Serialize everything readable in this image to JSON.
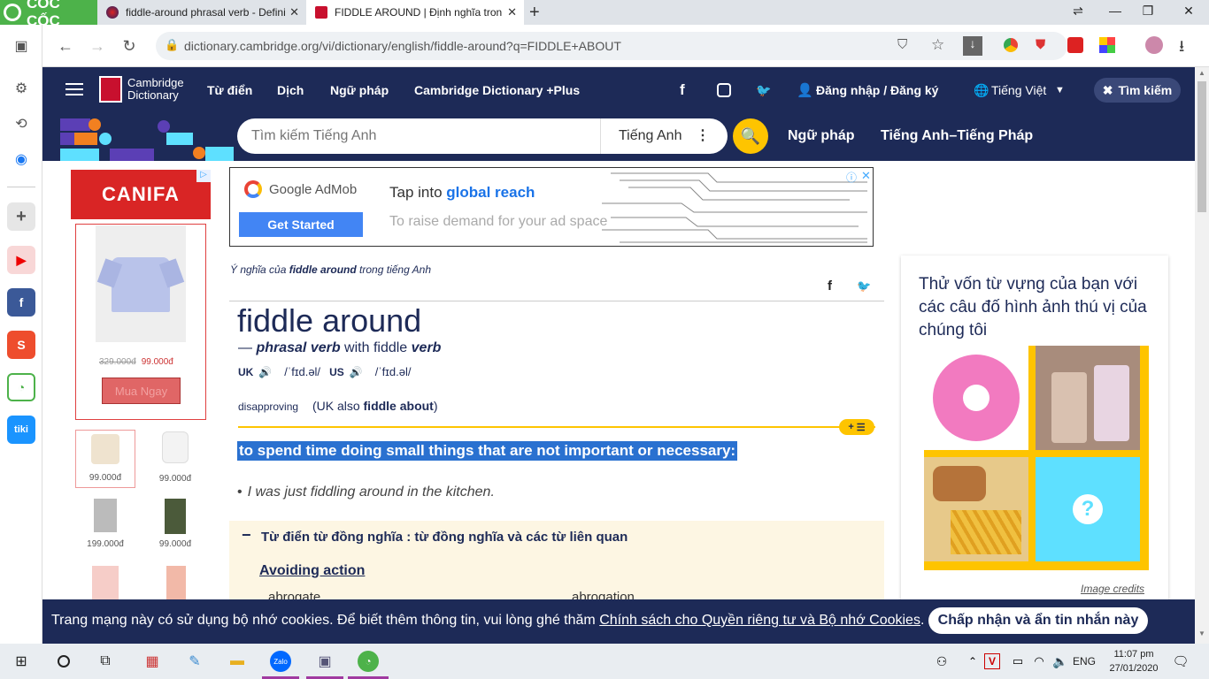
{
  "browser": {
    "brand": "CỐC CỐC",
    "tabs": [
      {
        "title": "fiddle-around phrasal verb - Defini"
      },
      {
        "title": "FIDDLE AROUND | Định nghĩa tron"
      }
    ],
    "url": "dictionary.cambridge.org/vi/dictionary/english/fiddle-around?q=FIDDLE+ABOUT"
  },
  "nav": {
    "logo_line1": "Cambridge",
    "logo_line2": "Dictionary",
    "items": [
      "Từ điển",
      "Dịch",
      "Ngữ pháp",
      "Cambridge Dictionary +Plus"
    ],
    "login": "Đăng nhập / Đăng ký",
    "language": "Tiếng Việt",
    "search_toggle": "Tìm kiếm"
  },
  "search": {
    "placeholder": "Tìm kiếm Tiếng Anh",
    "dictionary": "Tiếng Anh",
    "link_grammar": "Ngữ pháp",
    "link_pair": "Tiếng Anh–Tiếng Pháp"
  },
  "left_ad": {
    "brand": "CANIFA",
    "old_price": "329.000đ",
    "price": "99.000đ",
    "buy": "Mua Ngay",
    "thumbs": [
      "99.000đ",
      "99.000đ",
      "199.000đ",
      "99.000đ"
    ]
  },
  "admob": {
    "brand": "Google AdMob",
    "headline_plain": "Tap into ",
    "headline_bold": "global reach",
    "sub": "To raise demand for your ad space",
    "cta": "Get Started"
  },
  "entry": {
    "meaning_prefix": "Ý nghĩa của ",
    "meaning_word": "fiddle around",
    "meaning_suffix": " trong tiếng Anh",
    "headword": "fiddle around",
    "pos_dash": "— ",
    "pos": "phrasal verb",
    "pos_with": " with fiddle ",
    "pos_verb": "verb",
    "uk": "UK",
    "uk_ipa": "/ˈfɪd.əl/",
    "us": "US",
    "us_ipa": "/ˈfɪd.əl/",
    "register": "disapproving",
    "variant_open": "(UK also ",
    "variant_word": "fiddle about",
    "variant_close": ")",
    "plus_label": "+",
    "definition": "to spend time doing small things that are not important or necessary:",
    "example": "I was just fiddling around in the kitchen.",
    "thesaurus_title": "Từ điển từ đồng nghĩa : từ đồng nghĩa và các từ liên quan",
    "thesaurus_heading": "Avoiding action",
    "thesaurus_words": [
      "abrogate",
      "abrogation"
    ]
  },
  "quiz": {
    "title": "Thử vốn từ vựng của bạn với các câu đố hình ảnh thú vị của chúng tôi",
    "credits": "Image credits",
    "mystery": "?"
  },
  "cookie": {
    "text": "Trang mạng này có sử dụng bộ nhớ cookies. Để biết thêm thông tin, vui lòng ghé thăm ",
    "link": "Chính sách cho Quyền riêng tư và Bộ nhớ Cookies",
    "end": ".",
    "accept": "Chấp nhận và ẩn tin nhắn này"
  },
  "taskbar": {
    "lang": "ENG",
    "time": "11:07 pm",
    "date": "27/01/2020"
  },
  "colors": {
    "navy": "#1d2a57",
    "yellow": "#fec400",
    "highlight": "#2a71d0"
  }
}
